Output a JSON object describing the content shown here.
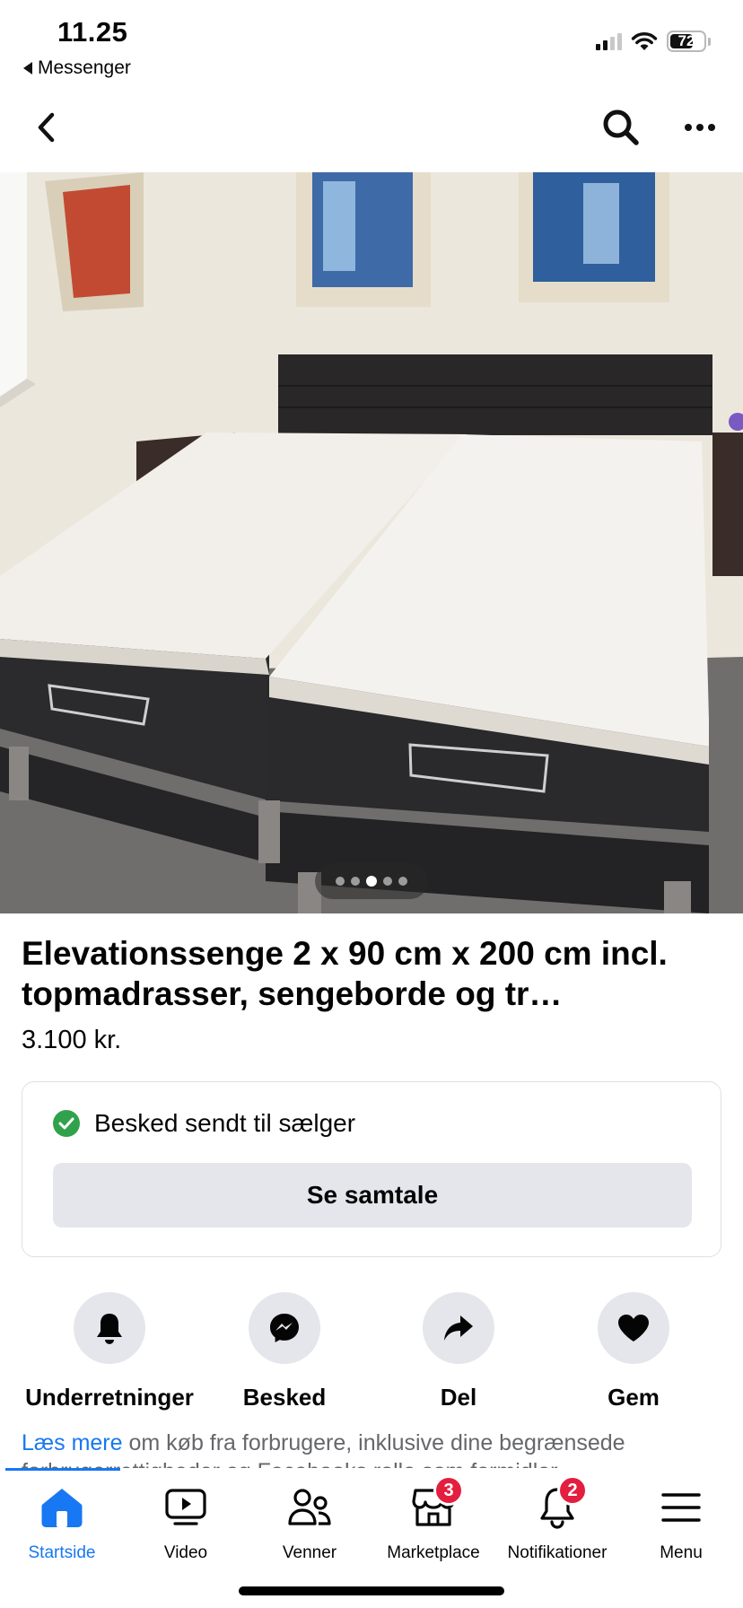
{
  "status_bar": {
    "time": "11.25",
    "back_app": "Messenger",
    "battery": "72",
    "battery_level": 0.72
  },
  "nav": {
    "back_icon": "chevron-left-icon",
    "search_icon": "search-icon",
    "more_icon": "more-horizontal-icon"
  },
  "photo": {
    "image_count": 5,
    "active_index": 3
  },
  "listing": {
    "title": "Elevationssenge 2 x 90 cm x 200 cm incl. topmadrasser, sengeborde og tr…",
    "price": "3.100 kr."
  },
  "message_card": {
    "status_text": "Besked sendt til sælger",
    "status_icon": "check-circle-icon",
    "status_color": "#31a24c",
    "button_label": "Se samtale"
  },
  "actions": [
    {
      "label": "Underretninger",
      "icon": "bell-icon"
    },
    {
      "label": "Besked",
      "icon": "messenger-icon"
    },
    {
      "label": "Del",
      "icon": "share-arrow-icon"
    },
    {
      "label": "Gem",
      "icon": "heart-icon"
    }
  ],
  "read_more": {
    "link": "Læs mere",
    "text": " om køb fra forbrugere, inklusive dine begrænsede",
    "text_cut": "forbrugerrettigheder og Facebooks rolle som formidler"
  },
  "tab_bar": {
    "accent_color": "#1877f2",
    "badge_color": "#e41e3f",
    "tabs": [
      {
        "label": "Startside",
        "icon": "home-icon",
        "active": true,
        "badge": ""
      },
      {
        "label": "Video",
        "icon": "video-icon",
        "active": false,
        "badge": ""
      },
      {
        "label": "Venner",
        "icon": "friends-icon",
        "active": false,
        "badge": ""
      },
      {
        "label": "Marketplace",
        "icon": "marketplace-icon",
        "active": false,
        "badge": "3"
      },
      {
        "label": "Notifikationer",
        "icon": "bell-icon",
        "active": false,
        "badge": "2"
      },
      {
        "label": "Menu",
        "icon": "menu-icon",
        "active": false,
        "badge": ""
      }
    ]
  }
}
